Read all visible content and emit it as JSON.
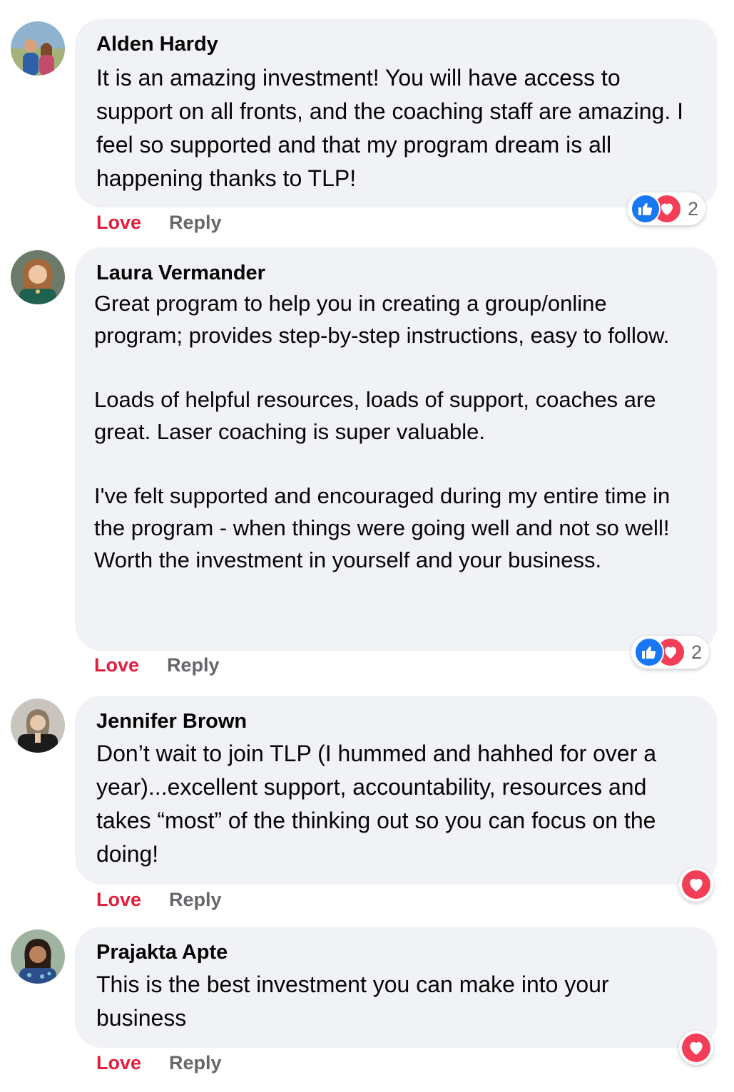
{
  "comments": [
    {
      "author": "Alden Hardy",
      "paragraphs": [
        "It is an amazing investment! You will have access to support on all fronts, and the coaching staff are amazing. I feel so supported and that my program dream is all happening thanks to TLP!"
      ],
      "love_label": "Love",
      "reply_label": "Reply",
      "reaction_icons": [
        "like-icon",
        "heart-icon"
      ],
      "reaction_count": "2"
    },
    {
      "author": "Laura Vermander",
      "paragraphs": [
        "Great program to help you in creating a group/online program; provides step-by-step instructions, easy to follow.",
        "Loads of helpful resources, loads of support, coaches are great. Laser coaching is super valuable.",
        "I've felt supported and encouraged during my entire time in the program - when things were going well and not so well! Worth the investment in yourself and your business."
      ],
      "love_label": "Love",
      "reply_label": "Reply",
      "reaction_icons": [
        "like-icon",
        "heart-icon"
      ],
      "reaction_count": "2"
    },
    {
      "author": "Jennifer Brown",
      "paragraphs": [
        "Don’t wait to join TLP (I hummed and hahhed for over a year)...excellent support, accountability, resources and takes “most” of the thinking out so you can focus on the doing!"
      ],
      "love_label": "Love",
      "reply_label": "Reply",
      "reaction_icons": [
        "heart-icon"
      ]
    },
    {
      "author": "Prajakta Apte",
      "paragraphs": [
        "This is the best investment you can make into your business"
      ],
      "love_label": "Love",
      "reply_label": "Reply",
      "reaction_icons": [
        "heart-icon"
      ]
    }
  ],
  "colors": {
    "bubble": "#f0f2f5",
    "love": "#e41e3f",
    "secondary_text": "#65676b",
    "like_blue": "#1877f2",
    "heart_red": "#f33e58"
  }
}
